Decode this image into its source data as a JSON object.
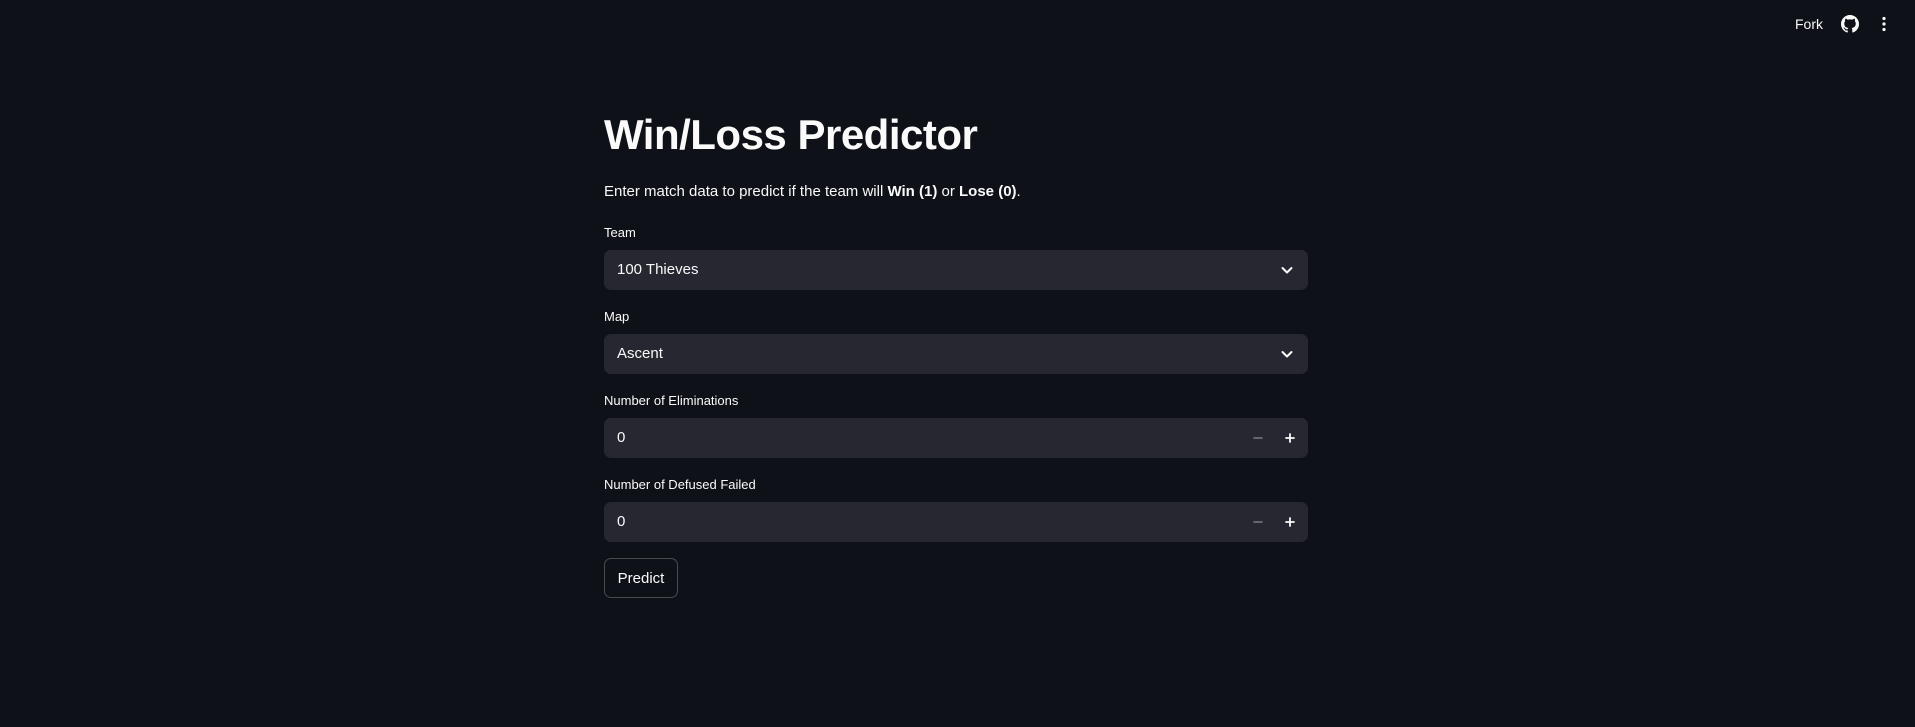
{
  "header": {
    "fork_label": "Fork",
    "icons": [
      "github-icon",
      "more-vertical-icon"
    ]
  },
  "main": {
    "title": "Win/Loss Predictor",
    "subtitle": {
      "prefix": "Enter match data to predict if the team will ",
      "win": "Win (1)",
      "middle": " or ",
      "lose": "Lose (0)",
      "suffix": "."
    },
    "team": {
      "label": "Team",
      "value": "100 Thieves"
    },
    "map": {
      "label": "Map",
      "value": "Ascent"
    },
    "eliminations": {
      "label": "Number of Eliminations",
      "value": "0"
    },
    "defused_failed": {
      "label": "Number of Defused Failed",
      "value": "0"
    },
    "predict_label": "Predict"
  },
  "colors": {
    "background": "#0e1117",
    "input_background": "#262730",
    "text": "#fafafa"
  }
}
